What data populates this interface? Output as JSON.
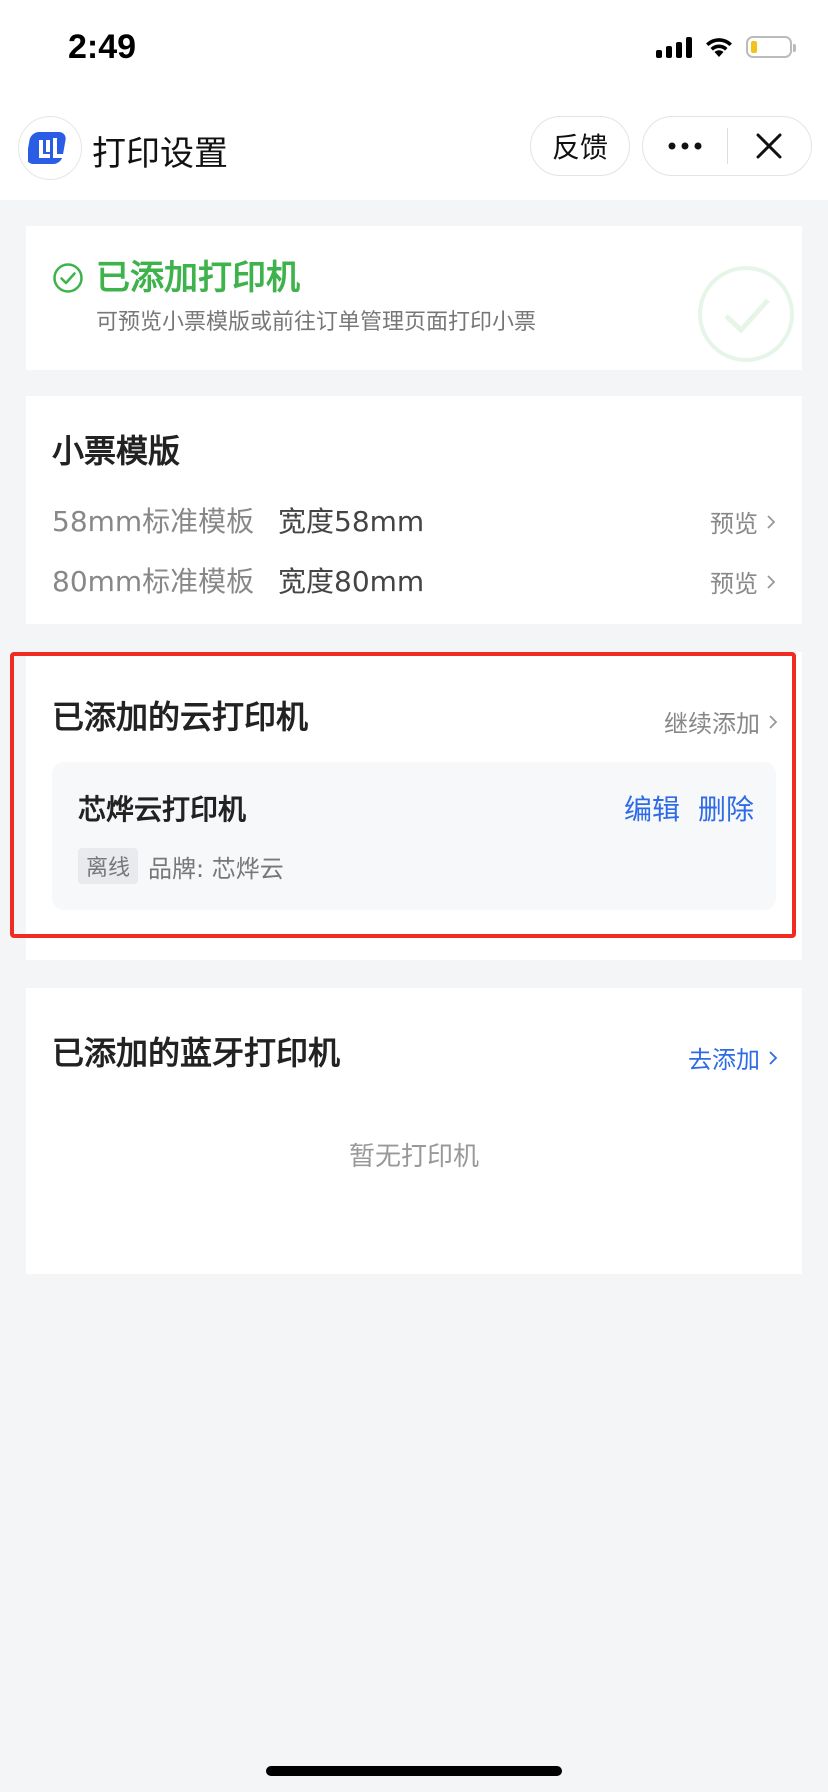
{
  "statusbar": {
    "time": "2:49",
    "battery_color": "#f2c318"
  },
  "navbar": {
    "logo_icon": "app-logo-icon",
    "title": "打印设置",
    "feedback_label": "反馈",
    "more_icon": "more-dots-icon",
    "close_icon": "close-icon"
  },
  "printer_status": {
    "icon": "check-circle-icon",
    "title": "已添加打印机",
    "subtitle": "可预览小票模版或前往订单管理页面打印小票",
    "accent_color": "#3eb24b"
  },
  "templates": {
    "title": "小票模版",
    "items": [
      {
        "name": "58mm标准模板",
        "width": "宽度58mm",
        "action": "预览"
      },
      {
        "name": "80mm标准模板",
        "width": "宽度80mm",
        "action": "预览"
      }
    ]
  },
  "cloud_printers": {
    "title": "已添加的云打印机",
    "add_link": "继续添加",
    "items": [
      {
        "name": "芯烨云打印机",
        "edit_label": "编辑",
        "delete_label": "删除",
        "status": "离线",
        "brand": "品牌: 芯烨云"
      }
    ],
    "highlight_color": "#f02b22"
  },
  "bluetooth_printers": {
    "title": "已添加的蓝牙打印机",
    "add_link": "去添加",
    "empty_text": "暂无打印机",
    "link_color": "#2e6be6"
  }
}
